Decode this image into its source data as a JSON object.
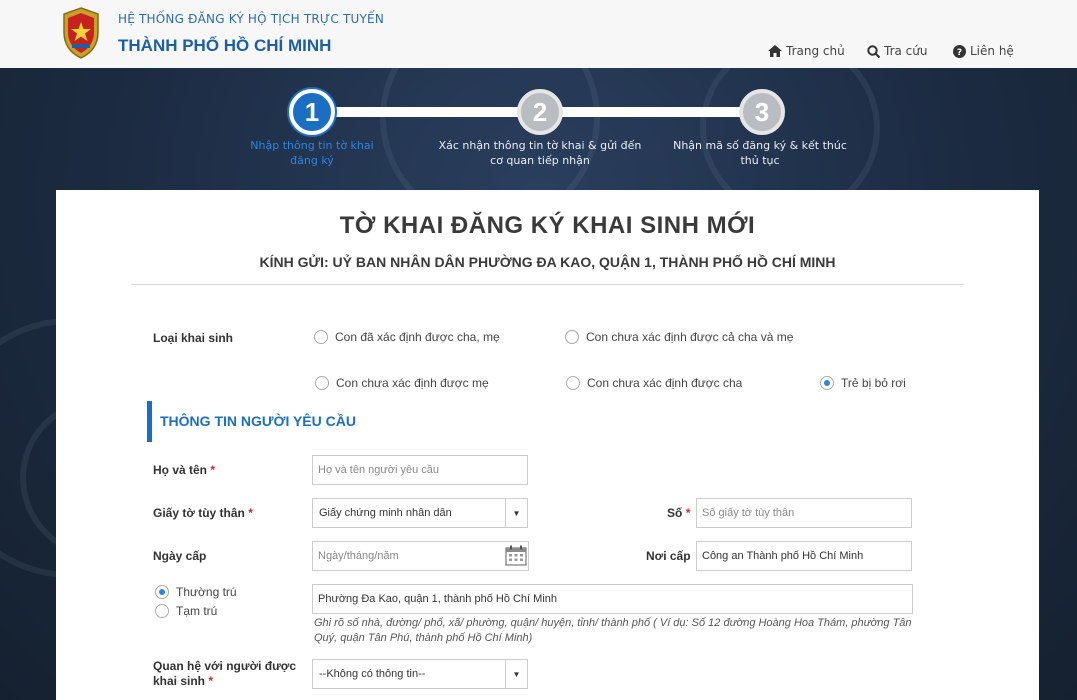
{
  "header": {
    "system_title": "HỆ THỐNG ĐĂNG KÝ HỘ TỊCH TRỰC TUYẾN",
    "city_title": "THÀNH PHỐ HỒ CHÍ MINH",
    "nav": [
      {
        "label": "Trang chủ",
        "icon": "home-icon"
      },
      {
        "label": "Tra cứu",
        "icon": "search-icon"
      },
      {
        "label": "Liên hệ",
        "icon": "question-icon"
      }
    ]
  },
  "steps": [
    {
      "number": "1",
      "label_line1": "Nhập thông tin tờ khai",
      "label_line2": "đăng ký",
      "active": true
    },
    {
      "number": "2",
      "label_line1": "Xác nhận thông tin tờ khai & gửi đến",
      "label_line2": "cơ quan tiếp nhận",
      "active": false
    },
    {
      "number": "3",
      "label_line1": "Nhận mã số đăng ký & kết thúc",
      "label_line2": "thủ tục",
      "active": false
    }
  ],
  "form": {
    "title": "TỜ KHAI ĐĂNG KÝ KHAI SINH MỚI",
    "subtitle": "KÍNH GỬI: UỶ BAN NHÂN DÂN PHƯỜNG ĐA KAO, QUẬN 1, THÀNH PHỐ HỒ CHÍ MINH",
    "birth_type_label": "Loại khai sinh",
    "birth_types": [
      {
        "label": "Con đã xác định được cha, mẹ",
        "selected": false
      },
      {
        "label": "Con chưa xác định được cả cha và mẹ",
        "selected": false
      },
      {
        "label": "Con chưa xác định được mẹ",
        "selected": false
      },
      {
        "label": "Con chưa xác định được cha",
        "selected": false
      },
      {
        "label": "Trẻ bị bỏ rơi",
        "selected": true
      }
    ],
    "section_title": "THÔNG TIN NGƯỜI YÊU CẦU",
    "name_label": "Họ và tên",
    "name_placeholder": "Họ và tên người yêu cầu",
    "id_doc_label": "Giấy tờ tùy thân",
    "id_doc_value": "Giấy chứng minh nhân dân",
    "id_number_label": "Số",
    "id_number_placeholder": "Số giấy tờ tùy thân",
    "issue_date_label": "Ngày cấp",
    "issue_date_placeholder": "Ngày/tháng/năm",
    "issue_place_label": "Nơi cấp",
    "issue_place_value": "Công an Thành phố Hồ Chí Minh",
    "residence_options": [
      {
        "label": "Thường trú",
        "selected": true
      },
      {
        "label": "Tạm trú",
        "selected": false
      }
    ],
    "address_value": "Phường Đa Kao, quận 1, thành phố Hồ Chí Minh",
    "address_hint": "Ghi rõ số nhà, đường/ phố, xã/ phường, quận/ huyện, tỉnh/ thành phố ( Ví dụ: Số 12 đường Hoàng Hoa Thám, phường Tân Quý, quận Tân Phú, thành phố Hồ Chí Minh)",
    "relation_label_line1": "Quan hệ với người được",
    "relation_label_line2": "khai sinh",
    "relation_value": "--Không có thông tin--",
    "required_mark": "*"
  },
  "colors": {
    "primary": "#1b6fc2",
    "banner": "#1f2f47",
    "required": "#dd2222"
  }
}
